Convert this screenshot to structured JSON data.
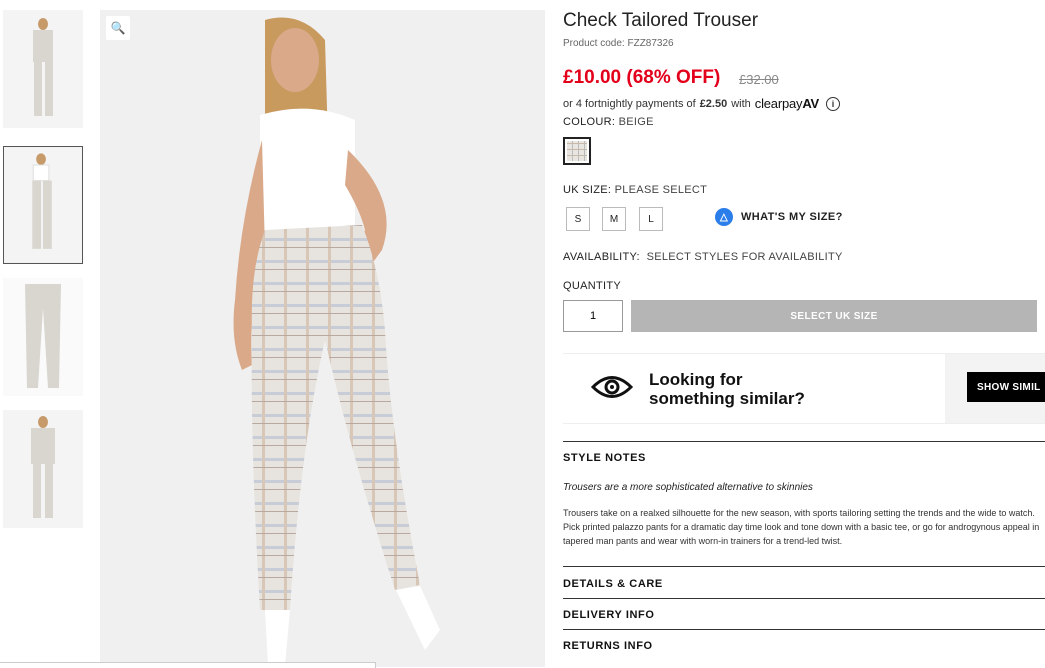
{
  "product": {
    "title": "Check Tailored Trouser",
    "code": "Product code: FZZ87326",
    "price": "£10.00 (68% OFF)",
    "old_price": "£32.00",
    "installments_prefix": "or 4 fortnightly payments of",
    "installments_amount": "£2.50",
    "installments_with": "with",
    "clearpay_logo": "clearpay",
    "colour_label": "COLOUR:",
    "colour_value": "BEIGE",
    "size_label": "UK SIZE:",
    "size_value": "PLEASE SELECT",
    "sizes": [
      "S",
      "M",
      "L"
    ],
    "whats_my_size": "WHAT'S MY SIZE?",
    "availability_label": "AVAILABILITY:",
    "availability_value": "SELECT STYLES FOR AVAILABILITY",
    "quantity_label": "QUANTITY",
    "quantity_value": "1",
    "add_button": "SELECT UK SIZE"
  },
  "similar": {
    "line1": "Looking for",
    "line2": "something similar?",
    "button": "SHOW SIMIL"
  },
  "style_notes": {
    "heading": "STYLE NOTES",
    "tagline": "Trousers are a more sophisticated alternative to skinnies",
    "body": "Trousers take on a realxed silhouette for the new season, with sports tailoring setting the trends and the wide to watch. Pick printed palazzo pants for a dramatic day time look and tone down with a basic tee, or go for androgynous appeal in tapered man pants and wear with worn-in trainers for a trend-led twist."
  },
  "accordions": [
    "DETAILS & CARE",
    "DELIVERY INFO",
    "RETURNS INFO"
  ],
  "icons": {
    "zoom": "zoom-icon",
    "info": "i",
    "hanger": "hanger-icon",
    "eye": "eye-icon"
  },
  "colors": {
    "price_red": "#e3001b",
    "button_disabled": "#b5b5b5",
    "size_blue": "#2b7de9"
  }
}
